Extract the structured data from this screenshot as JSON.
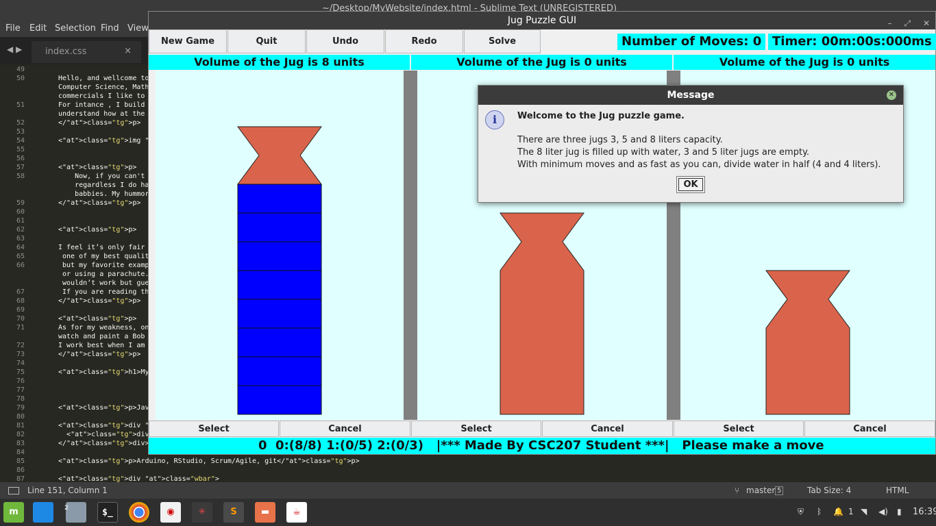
{
  "sublime": {
    "title": "~/Desktop/MyWebsite/index.html - Sublime Text (UNREGISTERED)",
    "menu": [
      "File",
      "Edit",
      "Selection",
      "Find",
      "View"
    ],
    "tab": "index.css",
    "code_lines": [
      {
        "n": "49",
        "t": ""
      },
      {
        "n": "50",
        "t": "Hello, and wellcome to"
      },
      {
        "n": "",
        "t": "Computer Science, Math"
      },
      {
        "n": "",
        "t": "commercials I like to"
      },
      {
        "n": "51",
        "t": "For intance , I build"
      },
      {
        "n": "",
        "t": "understand how at the"
      },
      {
        "n": "52",
        "t": "</p>"
      },
      {
        "n": "53",
        "t": ""
      },
      {
        "n": "54",
        "t": "<img src=\"img/lol.gif\""
      },
      {
        "n": "55",
        "t": ""
      },
      {
        "n": "56",
        "t": ""
      },
      {
        "n": "57",
        "t": "<p>"
      },
      {
        "n": "58",
        "t": "    Now, if you can't"
      },
      {
        "n": "",
        "t": "    regardless I do ha"
      },
      {
        "n": "",
        "t": "    babbies. My hummor"
      },
      {
        "n": "59",
        "t": "</p>"
      },
      {
        "n": "60",
        "t": ""
      },
      {
        "n": "61",
        "t": ""
      },
      {
        "n": "62",
        "t": "<p>"
      },
      {
        "n": "63",
        "t": ""
      },
      {
        "n": "64",
        "t": "I feel it’s only fair"
      },
      {
        "n": "65",
        "t": " one of my best qualit"
      },
      {
        "n": "66",
        "t": " but my favorite examp"
      },
      {
        "n": "",
        "t": " or using a parachute."
      },
      {
        "n": "",
        "t": " wouldn’t work but gue"
      },
      {
        "n": "67",
        "t": " If you are reading th"
      },
      {
        "n": "68",
        "t": "</p>"
      },
      {
        "n": "69",
        "t": ""
      },
      {
        "n": "70",
        "t": "<p>"
      },
      {
        "n": "71",
        "t": "As for my weakness, on"
      },
      {
        "n": "",
        "t": "watch and paint a Bob"
      },
      {
        "n": "72",
        "t": "I work best when I am"
      },
      {
        "n": "73",
        "t": "</p>"
      },
      {
        "n": "74",
        "t": ""
      },
      {
        "n": "75",
        "t": "<h1>My Skills</h1>"
      },
      {
        "n": "76",
        "t": ""
      },
      {
        "n": "77",
        "t": ""
      },
      {
        "n": "78",
        "t": ""
      },
      {
        "n": "79",
        "t": "<p>Java, Python, C/C++"
      },
      {
        "n": "80",
        "t": ""
      },
      {
        "n": "81",
        "t": "<div class=\"wbar\">"
      },
      {
        "n": "82",
        "t": "  <div class=\"gbar\" st"
      },
      {
        "n": "83",
        "t": "</div>"
      },
      {
        "n": "84",
        "t": ""
      },
      {
        "n": "85",
        "t": "<p>Arduino, RStudio, Scrum/Agile, git</p>"
      },
      {
        "n": "86",
        "t": ""
      },
      {
        "n": "87",
        "t": "<div class=\"wbar\">"
      }
    ],
    "status": {
      "position": "Line 151, Column 1",
      "branch": "master",
      "branch_count": "5",
      "tab_size": "Tab Size: 4",
      "syntax": "HTML"
    }
  },
  "jug_window": {
    "title": "Jug Puzzle GUI",
    "buttons": [
      "New Game",
      "Quit",
      "Undo",
      "Redo",
      "Solve"
    ],
    "moves_label": "Number of Moves: 0",
    "timer_label": "Timer: 00m:00s:000ms",
    "jugs": [
      {
        "header": "Volume of the Jug is 8 units",
        "capacity": 8,
        "filled": 8,
        "select": "Select",
        "cancel": "Cancel"
      },
      {
        "header": "Volume of the Jug is 0 units",
        "capacity": 5,
        "filled": 0,
        "select": "Select",
        "cancel": "Cancel"
      },
      {
        "header": "Volume of the Jug is 0 units",
        "capacity": 3,
        "filled": 0,
        "select": "Select",
        "cancel": "Cancel"
      }
    ],
    "status_bar": "0  0:(8/8) 1:(0/5) 2:(0/3)   |*** Made By CSC207 Student ***|   Please make a move",
    "colors": {
      "cyan": "#00ffff",
      "panel": "#e0ffff",
      "jug": "#d9644b",
      "water": "#0000ff",
      "divider": "#808080"
    }
  },
  "dialog": {
    "title": "Message",
    "icon": "info-icon",
    "lines": [
      "Welcome to the Jug puzzle game.",
      "There are three jugs 3, 5 and 8 liters capacity.",
      "The 8 liter jug is filled up with water, 3 and 5 liter jugs are empty.",
      "With minimum moves and as fast as you can, divide water in half (4 and 4 liters)."
    ],
    "ok": "OK"
  },
  "taskbar": {
    "folder_badge": "2",
    "notif_count": "1",
    "clock": "16:39"
  }
}
